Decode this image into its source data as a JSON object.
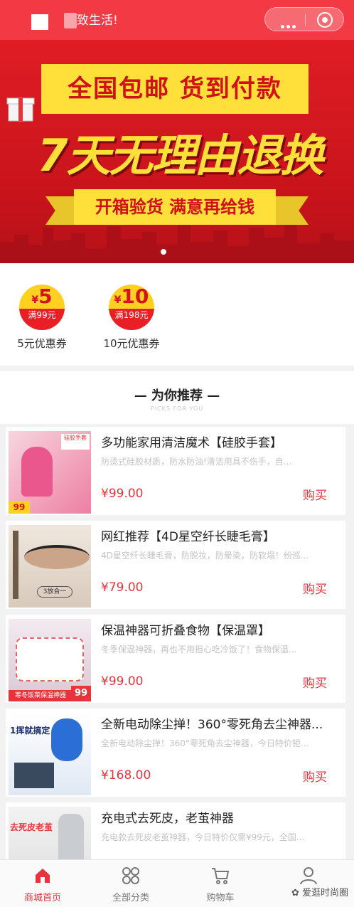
{
  "header": {
    "title": "致生活!"
  },
  "banner": {
    "line1": "全国包邮 货到付款",
    "line2": "7天无理由退换",
    "line3": "开箱验货 满意再给钱"
  },
  "coupons": [
    {
      "amount": "5",
      "currency": "¥",
      "condition": "满99元",
      "label": "5元优惠券"
    },
    {
      "amount": "10",
      "currency": "¥",
      "condition": "满198元",
      "label": "10元优惠券"
    }
  ],
  "recommend": {
    "title": "— 为你推荐 —",
    "subtitle": "PICKS FOR YOU"
  },
  "products": [
    {
      "name": "多功能家用清洁魔术【硅胶手套】",
      "desc": "防烫式硅胶材质，防水防油!清洁用具不伤手，自...",
      "price": "¥99.00",
      "buy": "购买",
      "thumb_text": "硅胶手套",
      "badge": "99"
    },
    {
      "name": "网红推荐【4D星空纤长睫毛膏】",
      "desc": "4D星空纤长睫毛膏，防脱妆，防晕染，防软塌！纷巡...",
      "price": "¥79.00",
      "buy": "购买",
      "thumb_text": "3放合一",
      "badge": ""
    },
    {
      "name": "保温神器可折叠食物【保温罩】",
      "desc": "冬季保温神器，再也不用担心吃冷饭了！食物保温...",
      "price": "¥99.00",
      "buy": "购买",
      "thumb_text": "寒冬饭菜保温神器",
      "badge": "99"
    },
    {
      "name": "全新电动除尘掸！360°零死角去尘神器...",
      "desc": "全新电动除尘掸！360°零死角去尘神器，今日特价钜...",
      "price": "¥168.00",
      "buy": "购买",
      "thumb_text": "1挥就搞定",
      "badge": ""
    },
    {
      "name": "充电式去死皮，老茧神器",
      "desc": "充电款去死皮老茧神器，今日特价仅需¥99元，全国...",
      "price": "",
      "buy": "",
      "thumb_text": "去死皮老茧",
      "badge": ""
    }
  ],
  "tabbar": [
    {
      "label": "商城首页",
      "icon": "home-icon",
      "active": true
    },
    {
      "label": "全部分类",
      "icon": "grid-icon",
      "active": false
    },
    {
      "label": "购物车",
      "icon": "cart-icon",
      "active": false
    },
    {
      "label": "",
      "icon": "user-icon",
      "active": false
    }
  ],
  "watermark": "爱逛时尚圈",
  "colors": {
    "accent": "#e8333c",
    "header": "#f33a44",
    "banner": "#d8161e",
    "yellow": "#ffe03a"
  }
}
